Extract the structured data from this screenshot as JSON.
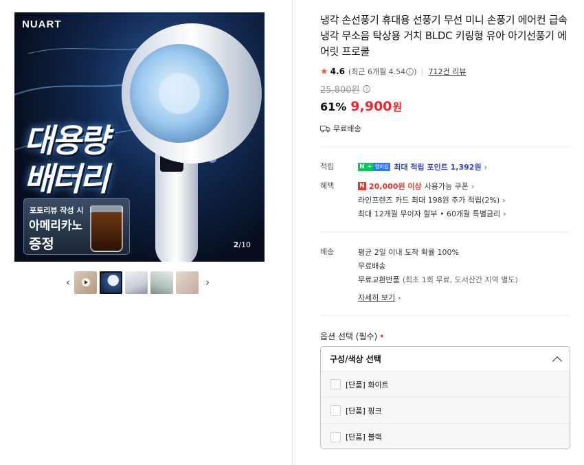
{
  "gallery": {
    "brand": "NUART",
    "hero_line1": "대용량",
    "hero_line2": "배터리",
    "promo_small": "포토리뷰 작성 시",
    "promo_big": "아메리카노",
    "promo_gift": "증정",
    "current": "2",
    "total": "/10",
    "prev_icon": "chevron-left-icon",
    "next_icon": "chevron-right-icon",
    "thumbnails": [
      "video",
      "product-fan",
      "model-1",
      "model-2",
      "pink-fan"
    ],
    "selected_thumbnail": 2
  },
  "product": {
    "title": "냉각 손선풍기 휴대용 선풍기 무선 미니 손풍기 에어컨 급속냉각 무소음 탁상용 거치 BLDC 키링형 유아 아기선풍기 에어릿 프로쿨",
    "rating": "4.6",
    "rating_recent": "(최근 6개월 4.54",
    "rating_close": ")",
    "reviews": "712건 리뷰",
    "original_price": "25,800원",
    "discount": "61%",
    "sale_price": "9,900",
    "currency": "원",
    "shipping": "무료배송"
  },
  "benefits": {
    "points_label": "적립",
    "membership_badge": "멤버십",
    "points_text": "최대 적립 포인트 1,392원",
    "perks_label": "혜택",
    "coupon_amount": "20,000원 이상",
    "coupon_text": "사용가능 쿠폰",
    "card_text": "라인프렌즈 카드 최대 198원 추가 적립(2%)",
    "installment_text": "최대 12개월 무이자 할부 • 60개월 특별금리"
  },
  "delivery": {
    "label": "배송",
    "line1": "평균 2일 이내 도착 확률 100%",
    "line2": "무료배송",
    "return_label": "무료교환반품",
    "return_detail": "(최초 1회 무료, 도서산간 지역 별도)",
    "more": "자세히 보기"
  },
  "options": {
    "title": "옵션 선택 (필수)",
    "required_mark": "•",
    "select_label": "구성/색상 선택",
    "items": [
      "[단품] 화이트",
      "[단품] 핑크",
      "[단품] 블랙"
    ]
  },
  "colors": {
    "sale_red": "#f4212e",
    "naver_green": "#03c75a",
    "points_blue": "#3446cc",
    "star": "#f5533d"
  }
}
